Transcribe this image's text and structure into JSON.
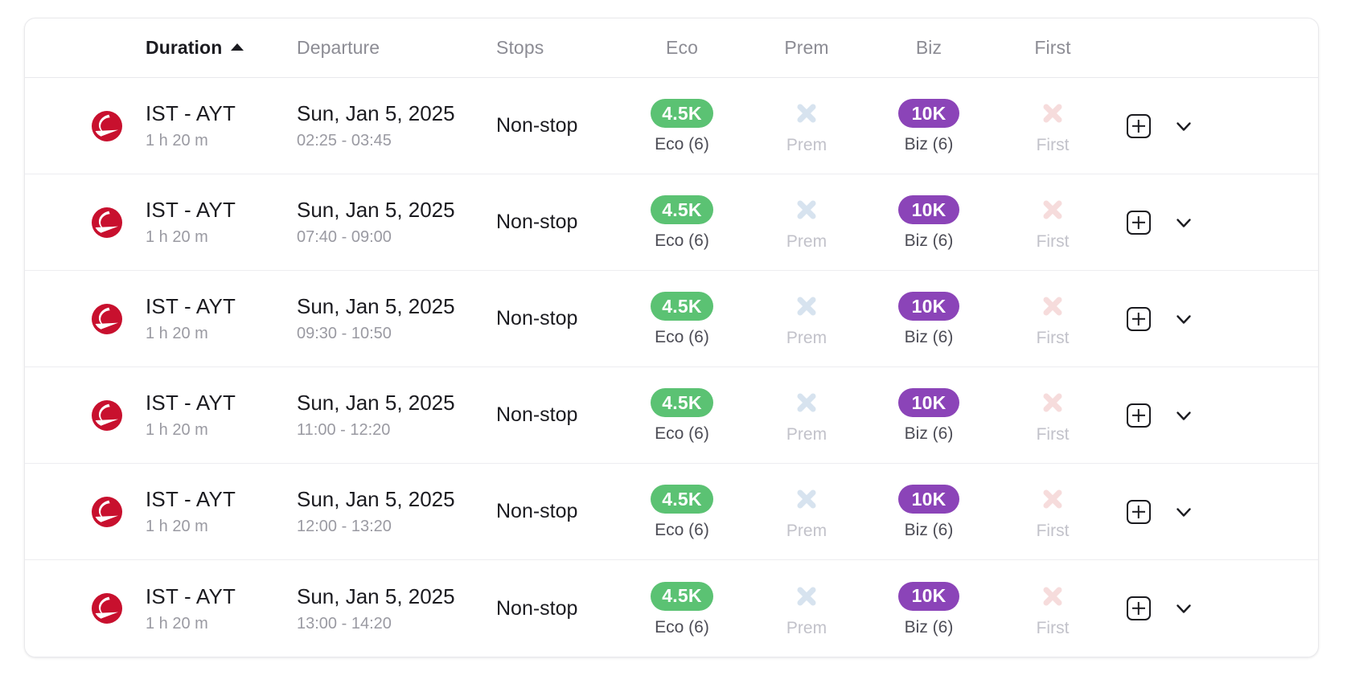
{
  "colors": {
    "eco_badge": "#5bc273",
    "biz_badge": "#8b44b8",
    "prem_unavailable": "#d7e3ef",
    "first_unavailable": "#f6dcdc",
    "airline_red": "#c8102e",
    "text_primary": "#1b1b20",
    "text_muted": "#9a9aa2",
    "border": "#e9e9ec"
  },
  "table": {
    "columns": [
      {
        "key": "airline",
        "label": "",
        "sorted": false,
        "align": "left"
      },
      {
        "key": "duration",
        "label": "Duration",
        "sorted": true,
        "sort_dir": "asc",
        "align": "left"
      },
      {
        "key": "departure",
        "label": "Departure",
        "sorted": false,
        "align": "left"
      },
      {
        "key": "stops",
        "label": "Stops",
        "sorted": false,
        "align": "left"
      },
      {
        "key": "eco",
        "label": "Eco",
        "sorted": false,
        "align": "center"
      },
      {
        "key": "prem",
        "label": "Prem",
        "sorted": false,
        "align": "center"
      },
      {
        "key": "biz",
        "label": "Biz",
        "sorted": false,
        "align": "center"
      },
      {
        "key": "first",
        "label": "First",
        "sorted": false,
        "align": "center"
      }
    ],
    "header": {
      "duration": "Duration",
      "departure": "Departure",
      "stops": "Stops",
      "eco": "Eco",
      "prem": "Prem",
      "biz": "Biz",
      "first": "First"
    }
  },
  "rows": [
    {
      "airline": "turkish-airlines",
      "route": "IST - AYT",
      "duration": "1 h 20 m",
      "departure_date": "Sun, Jan 5, 2025",
      "departure_times": "02:25 - 03:45",
      "stops": "Non-stop",
      "fares": {
        "eco": {
          "available": true,
          "price": "4.5K",
          "label": "Eco (6)"
        },
        "prem": {
          "available": false,
          "price": "",
          "label": "Prem"
        },
        "biz": {
          "available": true,
          "price": "10K",
          "label": "Biz (6)"
        },
        "first": {
          "available": false,
          "price": "",
          "label": "First"
        }
      }
    },
    {
      "airline": "turkish-airlines",
      "route": "IST - AYT",
      "duration": "1 h 20 m",
      "departure_date": "Sun, Jan 5, 2025",
      "departure_times": "07:40 - 09:00",
      "stops": "Non-stop",
      "fares": {
        "eco": {
          "available": true,
          "price": "4.5K",
          "label": "Eco (6)"
        },
        "prem": {
          "available": false,
          "price": "",
          "label": "Prem"
        },
        "biz": {
          "available": true,
          "price": "10K",
          "label": "Biz (6)"
        },
        "first": {
          "available": false,
          "price": "",
          "label": "First"
        }
      }
    },
    {
      "airline": "turkish-airlines",
      "route": "IST - AYT",
      "duration": "1 h 20 m",
      "departure_date": "Sun, Jan 5, 2025",
      "departure_times": "09:30 - 10:50",
      "stops": "Non-stop",
      "fares": {
        "eco": {
          "available": true,
          "price": "4.5K",
          "label": "Eco (6)"
        },
        "prem": {
          "available": false,
          "price": "",
          "label": "Prem"
        },
        "biz": {
          "available": true,
          "price": "10K",
          "label": "Biz (6)"
        },
        "first": {
          "available": false,
          "price": "",
          "label": "First"
        }
      }
    },
    {
      "airline": "turkish-airlines",
      "route": "IST - AYT",
      "duration": "1 h 20 m",
      "departure_date": "Sun, Jan 5, 2025",
      "departure_times": "11:00 - 12:20",
      "stops": "Non-stop",
      "fares": {
        "eco": {
          "available": true,
          "price": "4.5K",
          "label": "Eco (6)"
        },
        "prem": {
          "available": false,
          "price": "",
          "label": "Prem"
        },
        "biz": {
          "available": true,
          "price": "10K",
          "label": "Biz (6)"
        },
        "first": {
          "available": false,
          "price": "",
          "label": "First"
        }
      }
    },
    {
      "airline": "turkish-airlines",
      "route": "IST - AYT",
      "duration": "1 h 20 m",
      "departure_date": "Sun, Jan 5, 2025",
      "departure_times": "12:00 - 13:20",
      "stops": "Non-stop",
      "fares": {
        "eco": {
          "available": true,
          "price": "4.5K",
          "label": "Eco (6)"
        },
        "prem": {
          "available": false,
          "price": "",
          "label": "Prem"
        },
        "biz": {
          "available": true,
          "price": "10K",
          "label": "Biz (6)"
        },
        "first": {
          "available": false,
          "price": "",
          "label": "First"
        }
      }
    },
    {
      "airline": "turkish-airlines",
      "route": "IST - AYT",
      "duration": "1 h 20 m",
      "departure_date": "Sun, Jan 5, 2025",
      "departure_times": "13:00 - 14:20",
      "stops": "Non-stop",
      "fares": {
        "eco": {
          "available": true,
          "price": "4.5K",
          "label": "Eco (6)"
        },
        "prem": {
          "available": false,
          "price": "",
          "label": "Prem"
        },
        "biz": {
          "available": true,
          "price": "10K",
          "label": "Biz (6)"
        },
        "first": {
          "available": false,
          "price": "",
          "label": "First"
        }
      }
    }
  ],
  "icons": {
    "add_to_compare": "plus-square-icon",
    "expand_row": "chevron-down-icon",
    "sort_ascending": "triangle-up-icon",
    "unavailable": "x-icon"
  }
}
